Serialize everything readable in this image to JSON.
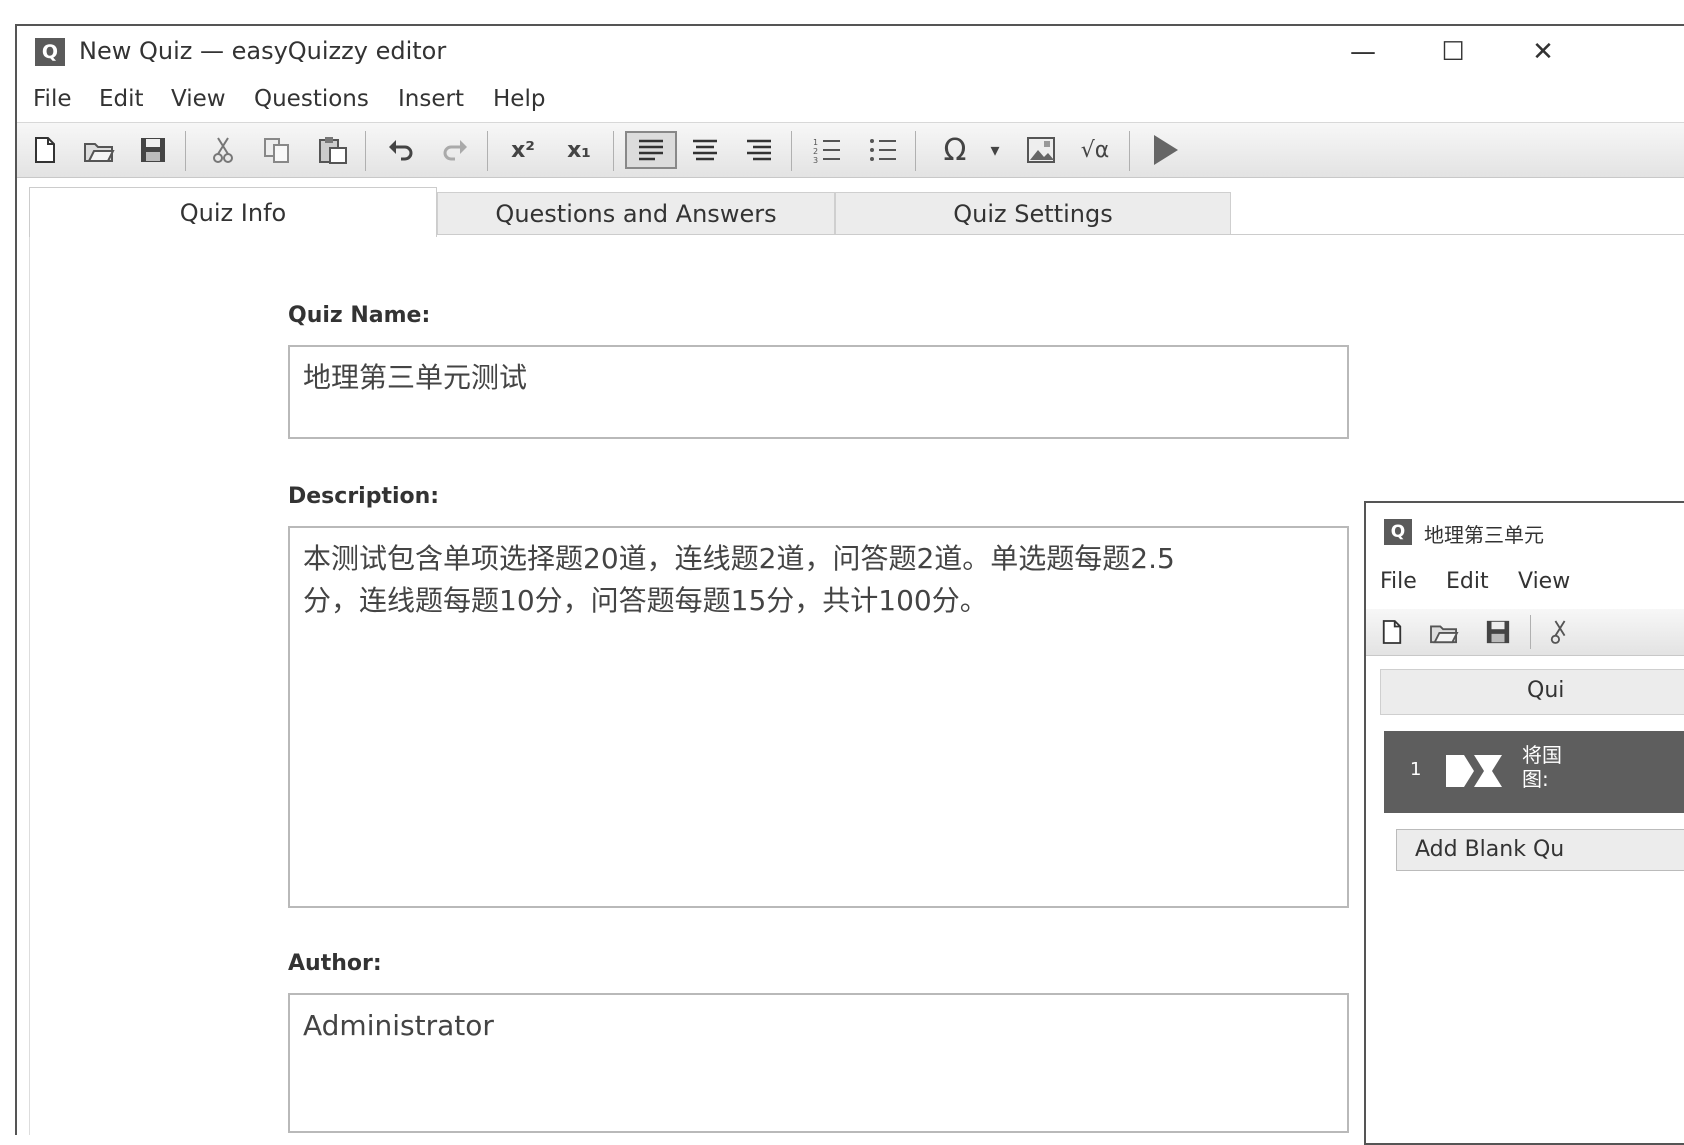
{
  "window": {
    "app_icon": "Q",
    "title": "New Quiz — easyQuizzy editor",
    "minimize": "—",
    "maximize": "☐",
    "close": "✕"
  },
  "menu": [
    "File",
    "Edit",
    "View",
    "Questions",
    "Insert",
    "Help"
  ],
  "toolbar": {
    "icons": [
      "new-document-icon",
      "open-folder-icon",
      "save-icon",
      "cut-icon",
      "copy-icon",
      "paste-icon",
      "undo-icon",
      "redo-icon",
      "superscript-icon",
      "subscript-icon",
      "align-left-icon",
      "align-center-icon",
      "align-right-icon",
      "numbered-list-icon",
      "bullet-list-icon",
      "omega-symbol-icon",
      "dropdown-arrow-icon",
      "insert-image-icon",
      "formula-icon",
      "play-preview-icon"
    ],
    "glyphs": {
      "omega": "Ω",
      "superscript": "x²",
      "subscript": "x₁",
      "formula": "√α",
      "dropdown": "▾"
    },
    "active_alignment": "align-left"
  },
  "tabs": [
    {
      "label": "Quiz Info",
      "active": true
    },
    {
      "label": "Questions and Answers",
      "active": false
    },
    {
      "label": "Quiz Settings",
      "active": false
    }
  ],
  "quiz_info": {
    "name_label": "Quiz Name:",
    "name_value": "地理第三单元测试",
    "description_label": "Description:",
    "description_line1": "本测试包含单项选择题20道，连线题2道，问答题2道。单选题每题2.5",
    "description_line2": "分，连线题每题10分，问答题每题15分，共计100分。",
    "author_label": "Author:",
    "author_value": "Administrator"
  },
  "preview_window": {
    "app_icon": "Q",
    "title": "地理第三单元",
    "menu": [
      "File",
      "Edit",
      "View"
    ],
    "tab_label": "Qui",
    "question_row": {
      "number": "1",
      "text_line1": "将国",
      "text_line2": "图:"
    },
    "add_button": "Add Blank Qu"
  },
  "colors": {
    "window_border": "#555555",
    "toolbar_gradient_top": "#f7f7f7",
    "toolbar_gradient_bottom": "#e3e3e3",
    "selected_row": "#5e5e5e",
    "tab_inactive": "#ececec"
  }
}
